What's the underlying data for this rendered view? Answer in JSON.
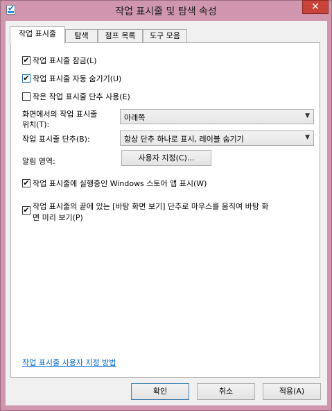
{
  "window": {
    "title": "작업 표시줄 및 탐색 속성",
    "close_glyph": "✕"
  },
  "tabs": [
    {
      "label": "작업 표시줄"
    },
    {
      "label": "탐색"
    },
    {
      "label": "점프 목록"
    },
    {
      "label": "도구 모음"
    }
  ],
  "options": {
    "lock_taskbar": {
      "label": "작업 표시줄 잠금(L)",
      "checked": true
    },
    "autohide": {
      "label": "작업 표시줄 자동 숨기기(U)",
      "checked": true
    },
    "small_buttons": {
      "label": "작은 작업 표시줄 단추 사용(E)",
      "checked": false
    }
  },
  "location": {
    "label_line1": "화면에서의 작업 표시줄",
    "label_line2": "위치(T):",
    "value": "아래쪽"
  },
  "buttons_combine": {
    "label": "작업 표시줄 단추(B):",
    "value": "항상 단추 하나로 표시, 레이블 숨기기"
  },
  "notification": {
    "label": "알림 영역:",
    "button": "사용자 지정(C)..."
  },
  "store_apps": {
    "label": "작업 표시줄에 실행중인 Windows 스토어 앱 표시(W)",
    "checked": true
  },
  "peek": {
    "line1": "작업 표시줄의 끝에 있는 [바탕 화면 보기] 단추로 마우스를 움직여 바탕 화",
    "line2": "면 미리 보기(P)",
    "checked": true
  },
  "help_link": "작업 표시줄 사용자 지정 방법",
  "footer": {
    "ok": "확인",
    "cancel": "취소",
    "apply": "적용(A)"
  },
  "icons": {
    "check": "✔",
    "dropdown": "▼"
  }
}
